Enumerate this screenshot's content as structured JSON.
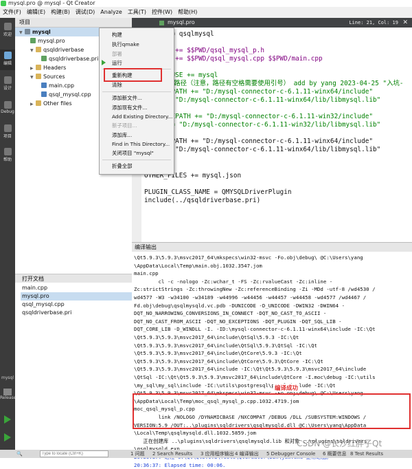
{
  "window": {
    "title": "mysql.pro @ mysql - Qt Creator"
  },
  "menu": [
    "文件(F)",
    "编辑(E)",
    "构建(B)",
    "调试(D)",
    "Analyze",
    "工具(T)",
    "控件(W)",
    "帮助(H)"
  ],
  "modes": [
    "欢迎",
    "编辑",
    "设计",
    "Debug",
    "项目",
    "帮助"
  ],
  "kit": {
    "name": "mysql",
    "config": "Release"
  },
  "project_panel": {
    "title": "项目",
    "tree": [
      {
        "label": "mysql",
        "depth": 0,
        "expanded": true,
        "type": "project"
      },
      {
        "label": "mysql.pro",
        "depth": 1,
        "type": "pro"
      },
      {
        "label": "qsqldriverbase",
        "depth": 1,
        "expanded": true,
        "type": "folder"
      },
      {
        "label": "qsqldriverbase.pri",
        "depth": 2,
        "type": "pri"
      },
      {
        "label": "Headers",
        "depth": 1,
        "expanded": false,
        "type": "folder"
      },
      {
        "label": "Sources",
        "depth": 1,
        "expanded": true,
        "type": "folder"
      },
      {
        "label": "main.cpp",
        "depth": 2,
        "type": "cpp"
      },
      {
        "label": "qsql_mysql.cpp",
        "depth": 2,
        "type": "cpp"
      },
      {
        "label": "Other files",
        "depth": 1,
        "expanded": false,
        "type": "folder"
      }
    ]
  },
  "open_docs": {
    "title": "打开文档",
    "items": [
      "main.cpp",
      "mysql.pro",
      "qsql_mysql.cpp",
      "qsqldriverbase.pri"
    ],
    "selected": 1
  },
  "context_menu": {
    "items": [
      {
        "label": "构建",
        "disabled": false
      },
      {
        "label": "执行qmake",
        "disabled": false
      },
      {
        "label": "部署",
        "disabled": true
      },
      {
        "label": "运行",
        "disabled": false
      },
      {
        "label": "重新构建",
        "disabled": false,
        "highlight": true
      },
      {
        "label": "清除",
        "disabled": false
      },
      {
        "label": "添加新文件...",
        "disabled": false
      },
      {
        "label": "添加现有文件...",
        "disabled": false
      },
      {
        "label": "Add Existing Directory...",
        "disabled": false
      },
      {
        "label": "新子项目...",
        "disabled": true
      },
      {
        "label": "添加库...",
        "disabled": false
      },
      {
        "label": "Find in This Directory...",
        "disabled": false
      },
      {
        "label": "关闭项目 \"mysql\"",
        "disabled": false
      },
      {
        "label": "折叠全部",
        "disabled": false
      }
    ]
  },
  "editor": {
    "file": "mysql.pro",
    "cursor": "Line: 21, Col: 19",
    "lines": [
      "TARGET = qsqlmysql",
      "",
      "HEADERS += $$PWD/qsql_mysql_p.h",
      "SOURCES += $$PWD/qsql_mysql.cpp $$PWD/main.cpp",
      "",
      "#QMAKE_USE += mysql",
      "#mysql库路径（注意，路径有空格需要使用引号） add by yang 2023-04-25 \"入坑-",
      "INCLUDEPATH += \"D:/mysql-connector-c-6.1.11-winx64/include\"",
      "LIBS += \"D:/mysql-connector-c-6.1.11-winx64/lib/libmysql.lib\"",
      "",
      "#INCLUDEPATH += \"D:/mysql-connector-c-6.1.11-win32/include\"",
      "#LIBS += \"D:/mysql-connector-c-6.1.11-win32/lib/libmysql.lib\"",
      "",
      "INCLUDEPATH += \"D:/mysql-connector-c-6.1.11-winx64/include\"",
      "LIBS += \"D:/mysql-connector-c-6.1.11-winx64/lib/libmysql.lib\"",
      "",
      "OTHER_FILES += mysql.json",
      "",
      "PLUGIN_CLASS_NAME = QMYSQLDriverPlugin",
      "include(../qsqldriverbase.pri)"
    ]
  },
  "output": {
    "title": "编译输出",
    "lines": [
      "\\Qt5.9.3\\5.9.3\\msvc2017_64\\mkspecs\\win32-msvc -Fo.obj\\debug\\ @C:\\Users\\yang",
      "\\AppData\\Local\\Temp\\main.obj.1032.3547.jom",
      "main.cpp",
      "        cl -c -nologo -Zc:wchar_t -FS -Zc:rvalueCast -Zc:inline -",
      "Zc:strictStrings -Zc:throwingNew -Zc:referenceBinding -Zi -MDd -utf-8 /wd4530 /",
      "wd4577 -W3 -w34100 -w34189 -w44996 -w44456 -w44457 -w44458 -wd4577 /wd4467 /",
      "Fd.obj\\debug\\qsqlmysqld.vc.pdb -DUNICODE -D_UNICODE -DWIN32 -DWIN64 -",
      "DQT_NO_NARROWING_CONVERSIONS_IN_CONNECT -DQT_NO_CAST_TO_ASCII -",
      "DQT_NO_CAST_FROM_ASCII -DQT_NO_EXCEPTIONS -DQT_PLUGIN -DQT_SQL_LIB -",
      "DQT_CORE_LIB -D_WINDLL -I. -ID:\\mysql-connector-c-6.1.11-winx64\\include -IC:\\Qt",
      "\\Qt5.9.3\\5.9.3\\msvc2017_64\\include\\QtSql\\5.9.3 -IC:\\Qt",
      "\\Qt5.9.3\\5.9.3\\msvc2017_64\\include\\QtSql\\5.9.3\\QtSql -IC:\\Qt",
      "\\Qt5.9.3\\5.9.3\\msvc2017_64\\include\\QtCore\\5.9.3 -IC:\\Qt",
      "\\Qt5.9.3\\5.9.3\\msvc2017_64\\include\\QtCore\\5.9.3\\QtCore -IC:\\Qt",
      "\\Qt5.9.3\\5.9.3\\msvc2017_64\\include -IC:\\Qt\\Qt5.9.3\\5.9.3\\msvc2017_64\\include",
      "\\QtSql -IC:\\Qt\\Qt5.9.3\\5.9.3\\msvc2017_64\\include\\QtCore -I.moc\\debug -IC:\\utils",
      "\\my_sql\\my_sql\\include -IC:\\utils\\postgresql\\pgsql\\include -IC:\\Qt",
      "\\Qt5.9.3\\5.9.3\\msvc2017_64\\mkspecs\\win32-msvc -Fo.obj\\debug\\ @C:\\Users\\yang",
      "\\AppData\\Local\\Temp\\moc_qsql_mysql_p.cpp.1032.4719.jom",
      "moc_qsql_mysql_p.cpp",
      "        link /NOLOGO /DYNAMICBASE /NXCOMPAT /DEBUG /DLL /SUBSYSTEM:WINDOWS /",
      "VERSION:5.9 /OUT:..\\plugins\\sqldrivers\\qsqlmysqld.dll @C:\\Users\\yang\\AppData",
      "\\Local\\Temp\\qsqlmysqld.dll.1032.5859.jom",
      "   正在创建库 ..\\plugins\\sqldrivers\\qsqlmysqld.lib 和对象 ..\\plugins\\sqldrivers",
      "\\qsqlmysqld.exp",
      "20:36:37: 进程\"C:\\Qt\\Qt5.9.3\\Tools\\QtCreator\\bin\\jom.exe\"正常退出。",
      "20:36:37: Elapsed time: 00:06."
    ],
    "annotation": "编译成功"
  },
  "status_bar": {
    "search_placeholder": "Type to locate (Ctrl+K)",
    "panes": [
      "1 问题",
      "2 Search Results",
      "3 应用程序输出",
      "4 编译输出",
      "5 Debugger Console",
      "6 概要信息",
      "8 Test Results"
    ]
  },
  "watermark": "CSDN @长沙红胖子Qt"
}
